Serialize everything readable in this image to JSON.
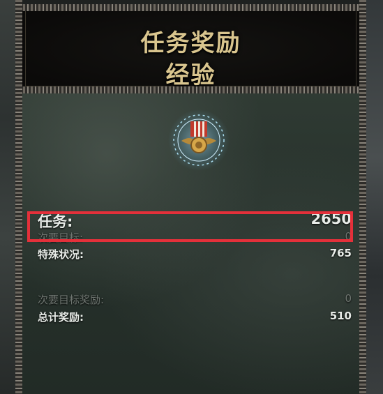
{
  "header": {
    "title_line1": "任务奖励",
    "title_line2": "经验"
  },
  "rewards": {
    "mission": {
      "label": "任务:",
      "value": "2650"
    },
    "secondary_objectives": {
      "label": "次要目标:",
      "value": "0"
    },
    "special_conditions": {
      "label": "特殊状况:",
      "value": "765"
    },
    "secondary_objective_reward": {
      "label": "次要目标奖励:",
      "value": "0"
    },
    "total_reward": {
      "label": "总计奖励:",
      "value": "510"
    }
  },
  "emblem": {
    "icon": "medal-icon"
  },
  "colors": {
    "title": "#d9c58e",
    "text": "#e8ece8",
    "dim_text": "#6f7671",
    "highlight_border": "#e4303a"
  }
}
